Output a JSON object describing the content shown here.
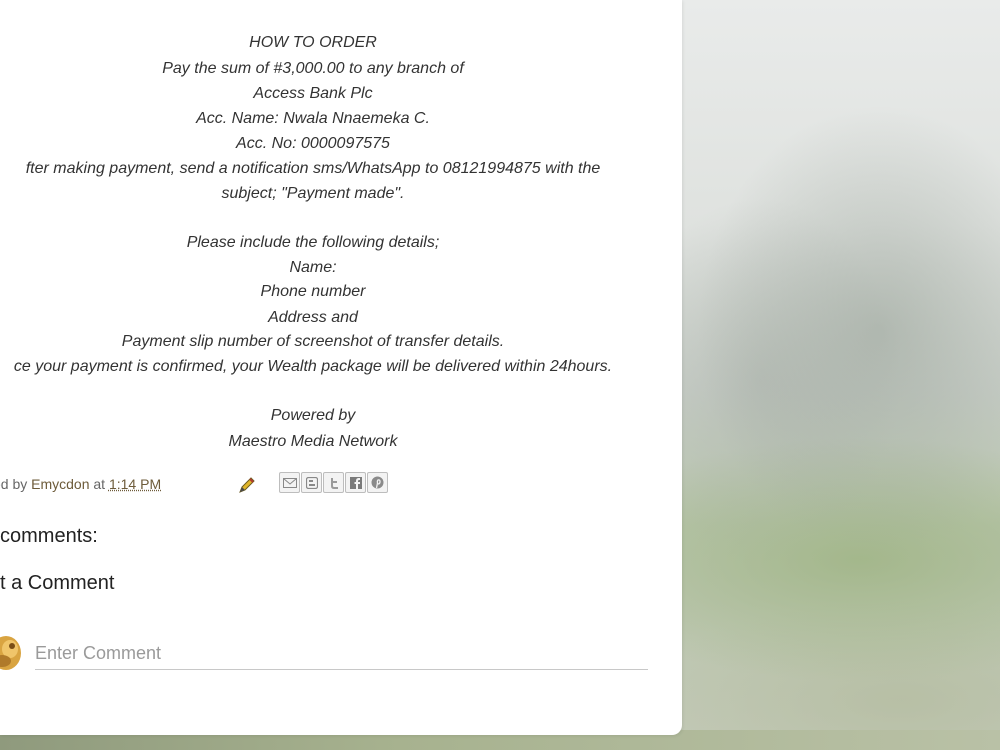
{
  "post": {
    "top_cut_text": "",
    "body_lines": [
      "HOW TO ORDER",
      "Pay the sum of #3,000.00 to any branch of",
      "Access Bank Plc",
      "Acc. Name: Nwala Nnaemeka C.",
      "Acc. No: 0000097575",
      "fter making payment, send a notification sms/WhatsApp to 08121994875 with the",
      "subject; \"Payment made\".",
      "",
      "Please include the following details;",
      "Name:",
      "Phone number",
      "Address and",
      "Payment slip number of screenshot of transfer details.",
      "ce your payment is confirmed, your Wealth package will be delivered within 24hours.",
      "",
      "Powered by",
      "Maestro Media Network"
    ]
  },
  "meta": {
    "posted_by_prefix": "ed by ",
    "author": "Emycdon",
    "at_text": " at ",
    "time": "1:14 PM"
  },
  "share": {
    "buttons": [
      "email",
      "blogger",
      "twitter",
      "facebook",
      "pinterest"
    ]
  },
  "comments": {
    "count_heading": "comments:",
    "post_heading": "st a Comment",
    "input_placeholder": "Enter Comment"
  },
  "colors": {
    "author_link": "#6d5b3a",
    "card_bg": "#ffffff"
  }
}
